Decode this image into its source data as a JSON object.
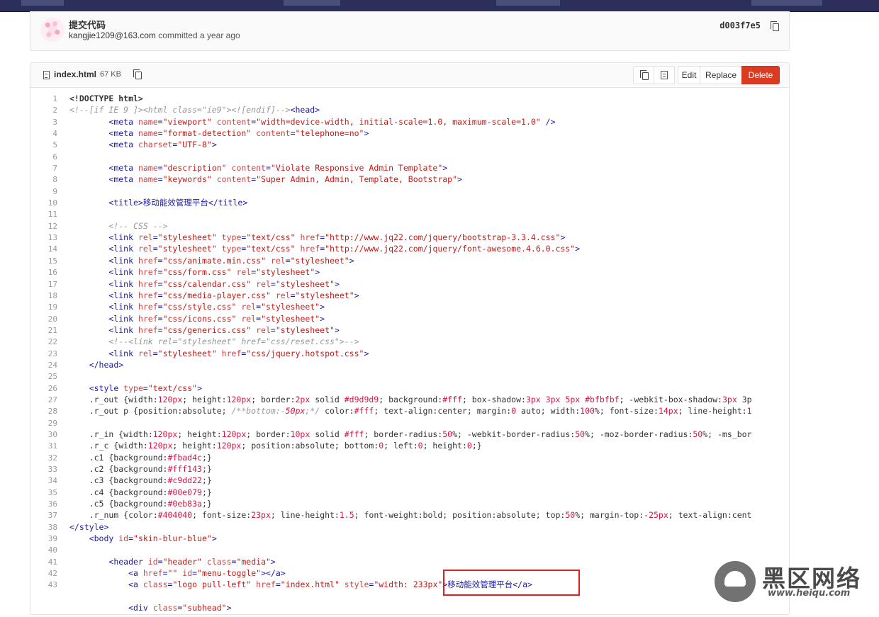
{
  "commit": {
    "title": "提交代码",
    "author": "kangjie1209@163.com",
    "action": "committed a year ago",
    "sha": "d003f7e5"
  },
  "file": {
    "name": "index.html",
    "size": "67 KB",
    "buttons": {
      "edit": "Edit",
      "replace": "Replace",
      "delete": "Delete"
    }
  },
  "code": {
    "line_numbers": [
      "1",
      "2",
      "3",
      "4",
      "5",
      "6",
      "7",
      "8",
      "9",
      "10",
      "11",
      "12",
      "13",
      "14",
      "15",
      "16",
      "17",
      "18",
      "19",
      "20",
      "21",
      "22",
      "23",
      "24",
      "25",
      "26",
      "27",
      "28",
      "29",
      "30",
      "31",
      "32",
      "33",
      "34",
      "35",
      "36",
      "37",
      "38",
      "39",
      "40",
      "41",
      "42",
      "43"
    ],
    "lines": [
      "<!DOCTYPE html>",
      "<!--[if IE 9 ]><html class=\"ie9\"><![endif]--><head>",
      "        <meta name=\"viewport\" content=\"width=device-width, initial-scale=1.0, maximum-scale=1.0\" />",
      "        <meta name=\"format-detection\" content=\"telephone=no\">",
      "        <meta charset=\"UTF-8\">",
      "",
      "        <meta name=\"description\" content=\"Violate Responsive Admin Template\">",
      "        <meta name=\"keywords\" content=\"Super Admin, Admin, Template, Bootstrap\">",
      "",
      "        <title>移动能效管理平台</title>",
      "",
      "        <!-- CSS -->",
      "        <link rel=\"stylesheet\" type=\"text/css\" href=\"http://www.jq22.com/jquery/bootstrap-3.3.4.css\">",
      "        <link rel=\"stylesheet\" type=\"text/css\" href=\"http://www.jq22.com/jquery/font-awesome.4.6.0.css\">",
      "        <link href=\"css/animate.min.css\" rel=\"stylesheet\">",
      "        <link href=\"css/form.css\" rel=\"stylesheet\">",
      "        <link href=\"css/calendar.css\" rel=\"stylesheet\">",
      "        <link href=\"css/media-player.css\" rel=\"stylesheet\">",
      "        <link href=\"css/style.css\" rel=\"stylesheet\">",
      "        <link href=\"css/icons.css\" rel=\"stylesheet\">",
      "        <link href=\"css/generics.css\" rel=\"stylesheet\">",
      "        <!--<link rel=\"stylesheet\" href=\"css/reset.css\">-->",
      "        <link rel=\"stylesheet\" href=\"css/jquery.hotspot.css\">",
      "    </head>",
      "",
      "    <style type=\"text/css\">",
      "    .r_out {width:120px; height:120px; border:2px solid #d9d9d9; background:#fff; box-shadow:3px 3px 5px #bfbfbf; -webkit-box-shadow:3px 3p",
      "    .r_out p {position:absolute; /**bottom:-50px;*/ color:#fff; text-align:center; margin:0 auto; width:100%; font-size:14px; line-height:1",
      "",
      "    .r_in {width:120px; height:120px; border:10px solid #fff; border-radius:50%; -webkit-border-radius:50%; -moz-border-radius:50%; -ms_bor",
      "    .r_c {width:120px; height:120px; position:absolute; bottom:0; left:0; height:0;}",
      "    .c1 {background:#fbad4c;}",
      "    .c2 {background:#fff143;}",
      "    .c3 {background:#c9dd22;}",
      "    .c4 {background:#00e079;}",
      "    .c5 {background:#0eb83a;}",
      "    .r_num {color:#404040; font-size:23px; line-height:1.5; font-weight:bold; position:absolute; top:50%; margin-top:-25px; text-align:cent",
      "</style>",
      "    <body id=\"skin-blur-blue\">",
      "",
      "        <header id=\"header\" class=\"media\">",
      "            <a href=\"\" id=\"menu-toggle\"></a>",
      "            <a class=\"logo pull-left\" href=\"index.html\" style=\"width: 233px\">移动能效管理平台</a>",
      "",
      "            <div class=\"subhead\">"
    ]
  },
  "watermark": {
    "text": "黑区网络",
    "url": "www.heiqu.com"
  },
  "colors": {
    "delete_button": "#db3b21",
    "highlight_box": "#e02020"
  }
}
